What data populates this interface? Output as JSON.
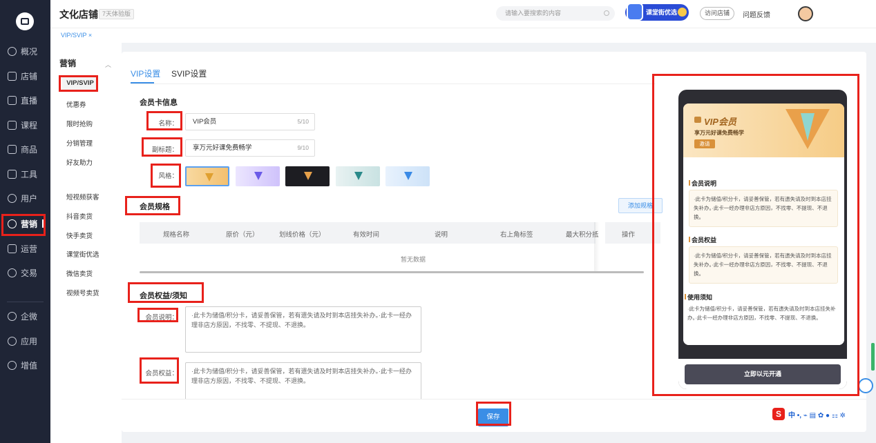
{
  "sidebar": {
    "items": [
      {
        "label": "概况",
        "icon": "clock-icon"
      },
      {
        "label": "店铺",
        "icon": "store-icon"
      },
      {
        "label": "直播",
        "icon": "video-icon"
      },
      {
        "label": "课程",
        "icon": "book-icon"
      },
      {
        "label": "商品",
        "icon": "goods-icon"
      },
      {
        "label": "工具",
        "icon": "toolbox-icon"
      },
      {
        "label": "用户",
        "icon": "user-icon"
      },
      {
        "label": "营销",
        "icon": "marketing-icon"
      },
      {
        "label": "运营",
        "icon": "monitor-icon"
      },
      {
        "label": "交易",
        "icon": "exchange-icon"
      },
      {
        "label": "企微",
        "icon": "wecom-icon"
      },
      {
        "label": "应用",
        "icon": "apps-icon"
      },
      {
        "label": "增值",
        "icon": "addon-icon"
      }
    ]
  },
  "header": {
    "shop_name": "文化店铺",
    "trial_badge": "7天体验版",
    "search_placeholder": "请输入要搜索的内容",
    "promo_label": "课堂街优选",
    "visit_label": "访问店铺",
    "feedback_label": "问题反馈"
  },
  "tabstrip": {
    "tab": "VIP/SVIP ×"
  },
  "submenu": {
    "title": "营销",
    "items": [
      "VIP/SVIP",
      "优惠券",
      "限时抢购",
      "分销管理",
      "好友助力",
      "短视频获客",
      "抖音卖货",
      "快手卖货",
      "课堂街优选",
      "微信卖货",
      "视频号卖货"
    ]
  },
  "panel": {
    "tabs": [
      "VIP设置",
      "SVIP设置"
    ],
    "card_info_title": "会员卡信息",
    "name_label": "名称：",
    "name_value": "VIP会员",
    "name_count": "5/10",
    "subtitle_label": "副标题：",
    "subtitle_value": "享万元好课免费畅学",
    "subtitle_count": "9/10",
    "style_label": "风格：",
    "spec_title": "会员规格",
    "add_spec": "添加规格",
    "table_headers": [
      "规格名称",
      "原价（元）",
      "划线价格（元）",
      "有效时间",
      "说明",
      "右上角标签",
      "最大积分抵",
      "操作"
    ],
    "empty_text": "暂无数据",
    "rights_title": "会员权益/须知",
    "desc_label": "会员说明：",
    "desc_text": "·此卡为储值/积分卡，请妥善保管，若有遗失请及时到本店挂失补办。·此卡一经办理非店方原因，不找零、不提现、不退换。",
    "rights_label": "会员权益：",
    "rights_text": "·此卡为储值/积分卡，请妥善保管，若有遗失请及时到本店挂失补办。·此卡一经办理非店方原因，不找零、不提现、不退换。",
    "save_label": "保存"
  },
  "preview": {
    "card_title": "VIP会员",
    "card_subtitle": "享万元好课免费畅学",
    "card_button": "邀请",
    "desc_heading": "会员说明",
    "desc_text": "·此卡为储值/积分卡，请妥善保管，若有遗失请及时到本店挂失补办。·此卡一经办理非店方原因，不找零、不提现、不退换。",
    "rights_heading": "会员权益",
    "rights_text": "·此卡为储值/积分卡，请妥善保管，若有遗失请及时到本店挂失补办。·此卡一经办理非店方原因，不找零、不提现、不退换。",
    "notice_heading": "使用须知",
    "notice_text": "·此卡为储值/积分卡，请妥善保管，若有遗失请及时到本店挂失补办。·此卡一经办理非店方原因，不找零、不提现、不退换。",
    "open_button": "立即以元开通"
  },
  "ime": {
    "label": "中 •, ⌁ ▤ ✿ ● ⚏ ✲"
  },
  "colors": {
    "accent": "#3a8ee6",
    "highlight": "#e8211b",
    "sidebar": "#1f2536"
  }
}
